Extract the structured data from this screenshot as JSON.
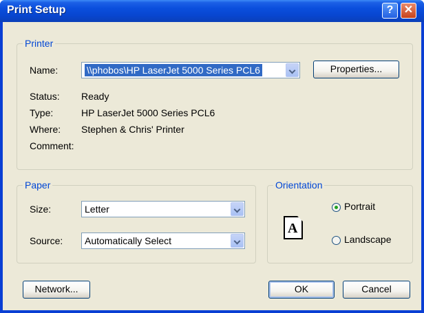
{
  "title": "Print Setup",
  "titlebar": {
    "help_label": "?",
    "close_label": "✕"
  },
  "printer": {
    "legend": "Printer",
    "name_label": "Name:",
    "name_value": "\\\\phobos\\HP LaserJet 5000 Series PCL6",
    "properties_label": "Properties...",
    "status_label": "Status:",
    "status_value": "Ready",
    "type_label": "Type:",
    "type_value": "HP LaserJet 5000 Series PCL6",
    "where_label": "Where:",
    "where_value": "Stephen & Chris' Printer",
    "comment_label": "Comment:",
    "comment_value": ""
  },
  "paper": {
    "legend": "Paper",
    "size_label": "Size:",
    "size_value": "Letter",
    "source_label": "Source:",
    "source_value": "Automatically Select"
  },
  "orientation": {
    "legend": "Orientation",
    "portrait_label": "Portrait",
    "landscape_label": "Landscape",
    "selected": "Portrait",
    "page_glyph": "A"
  },
  "buttons": {
    "network": "Network...",
    "ok": "OK",
    "cancel": "Cancel"
  }
}
